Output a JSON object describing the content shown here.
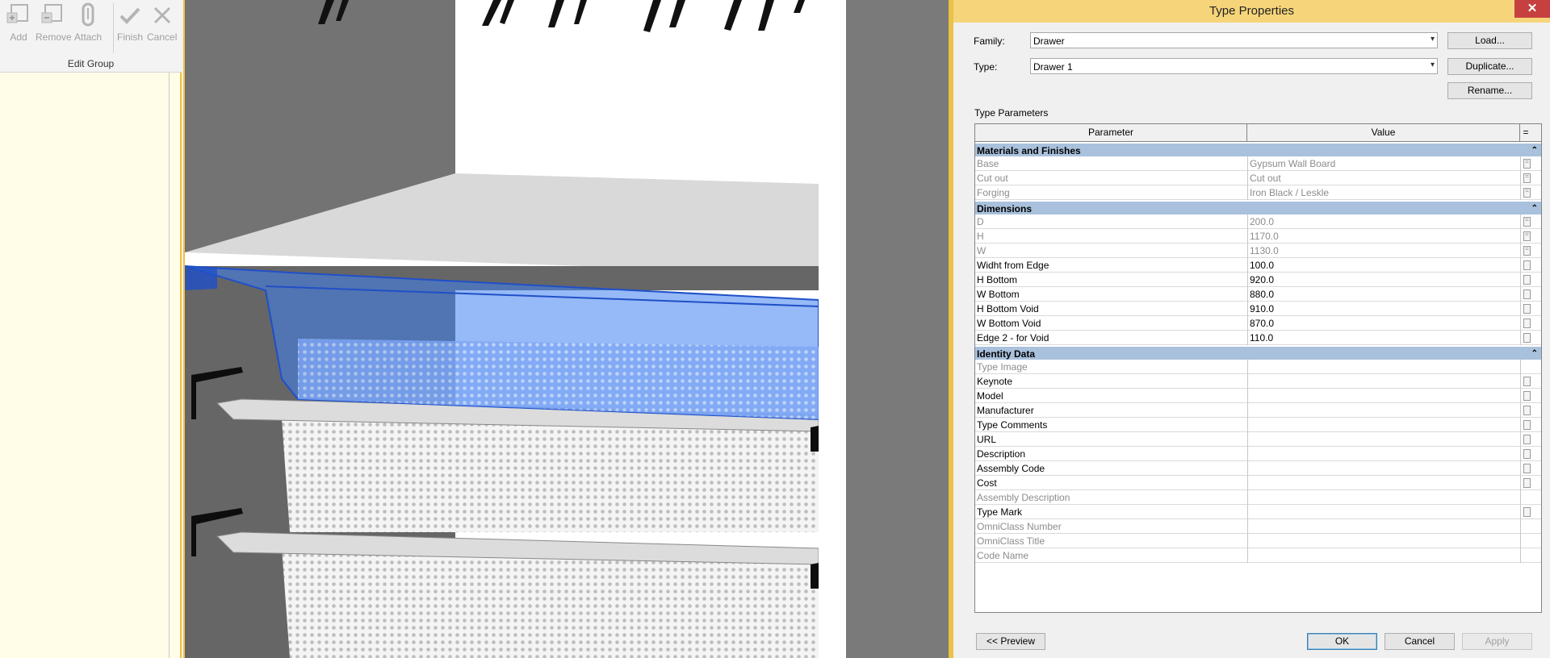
{
  "ribbon": {
    "buttons": [
      {
        "label": "Add",
        "icon": "add-to-group-icon"
      },
      {
        "label": "Remove",
        "icon": "remove-from-group-icon"
      },
      {
        "label": "Attach",
        "icon": "attach-icon"
      },
      {
        "label": "Finish",
        "icon": "checkmark-icon"
      },
      {
        "label": "Cancel",
        "icon": "close-x-icon"
      }
    ],
    "group_label": "Edit Group"
  },
  "dialog": {
    "title": "Type Properties",
    "close_glyph": "✕",
    "family_label": "Family:",
    "family_value": "Drawer",
    "type_label": "Type:",
    "type_value": "Drawer 1",
    "load_button": "Load...",
    "duplicate_button": "Duplicate...",
    "rename_button": "Rename...",
    "section_label": "Type Parameters",
    "col_parameter": "Parameter",
    "col_value": "Value",
    "col_eq": "=",
    "groups": [
      {
        "name": "Materials and Finishes",
        "rows": [
          {
            "name": "Base",
            "value": "Gypsum Wall Board",
            "greyed": true,
            "btn": "="
          },
          {
            "name": "Cut out",
            "value": "Cut out",
            "greyed": true,
            "btn": "="
          },
          {
            "name": "Forging",
            "value": "Iron Black / Leskle",
            "greyed": true,
            "btn": "="
          }
        ]
      },
      {
        "name": "Dimensions",
        "rows": [
          {
            "name": "D",
            "value": "200.0",
            "greyed": true,
            "btn": "="
          },
          {
            "name": "H",
            "value": "1170.0",
            "greyed": true,
            "btn": "="
          },
          {
            "name": "W",
            "value": "1130.0",
            "greyed": true,
            "btn": "="
          },
          {
            "name": "Widht from Edge",
            "value": "100.0",
            "greyed": false,
            "btn": ""
          },
          {
            "name": "H Bottom",
            "value": "920.0",
            "greyed": false,
            "btn": ""
          },
          {
            "name": "W Bottom",
            "value": "880.0",
            "greyed": false,
            "btn": ""
          },
          {
            "name": "H Bottom Void",
            "value": "910.0",
            "greyed": false,
            "btn": ""
          },
          {
            "name": "W Bottom Void",
            "value": "870.0",
            "greyed": false,
            "btn": ""
          },
          {
            "name": "Edge 2 - for Void",
            "value": "110.0",
            "greyed": false,
            "btn": ""
          }
        ]
      },
      {
        "name": "Identity Data",
        "rows": [
          {
            "name": "Type Image",
            "value": "",
            "greyed": true,
            "btn": null
          },
          {
            "name": "Keynote",
            "value": "",
            "greyed": false,
            "btn": ""
          },
          {
            "name": "Model",
            "value": "",
            "greyed": false,
            "btn": ""
          },
          {
            "name": "Manufacturer",
            "value": "",
            "greyed": false,
            "btn": ""
          },
          {
            "name": "Type Comments",
            "value": "",
            "greyed": false,
            "btn": ""
          },
          {
            "name": "URL",
            "value": "",
            "greyed": false,
            "btn": ""
          },
          {
            "name": "Description",
            "value": "",
            "greyed": false,
            "btn": ""
          },
          {
            "name": "Assembly Code",
            "value": "",
            "greyed": false,
            "btn": ""
          },
          {
            "name": "Cost",
            "value": "",
            "greyed": false,
            "btn": ""
          },
          {
            "name": "Assembly Description",
            "value": "",
            "greyed": true,
            "btn": null
          },
          {
            "name": "Type Mark",
            "value": "",
            "greyed": false,
            "btn": ""
          },
          {
            "name": "OmniClass Number",
            "value": "",
            "greyed": true,
            "btn": null
          },
          {
            "name": "OmniClass Title",
            "value": "",
            "greyed": true,
            "btn": null
          },
          {
            "name": "Code Name",
            "value": "",
            "greyed": true,
            "btn": null
          }
        ]
      }
    ],
    "preview_button": "<< Preview",
    "ok_button": "OK",
    "cancel_button": "Cancel",
    "apply_button": "Apply"
  },
  "colors": {
    "title_bar": "#f6d57a",
    "group_header": "#a9c1dc",
    "selection_blue": "#3f7ff0",
    "left_panel": "#fffde8"
  }
}
